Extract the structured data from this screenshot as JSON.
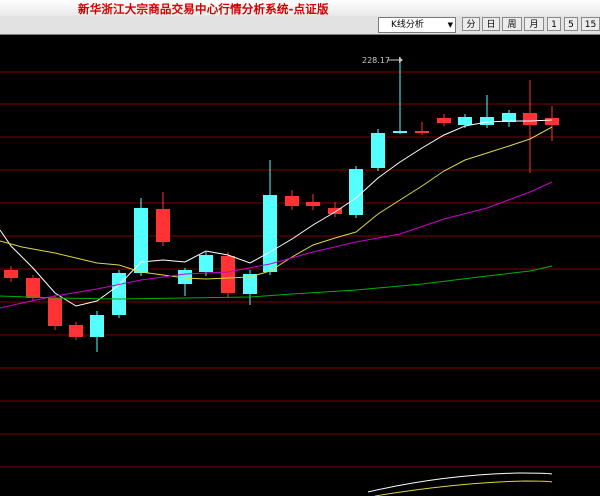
{
  "window": {
    "title": "新华浙江大宗商品交易中心行情分析系统-点证版"
  },
  "toolbar": {
    "analysis_select": "K线分析",
    "buttons": [
      "分",
      "日",
      "周",
      "月",
      "1",
      "5",
      "15"
    ]
  },
  "chart": {
    "max_price_label": "228.17",
    "colors": {
      "background": "#000000",
      "gridline": "#800000",
      "up_candle": "#ff3333",
      "down_candle": "#54ffff",
      "ma_white": "#ffffff",
      "ma_yellow": "#d8d840",
      "ma_magenta": "#cc00cc",
      "ma_green": "#00b000"
    }
  }
}
